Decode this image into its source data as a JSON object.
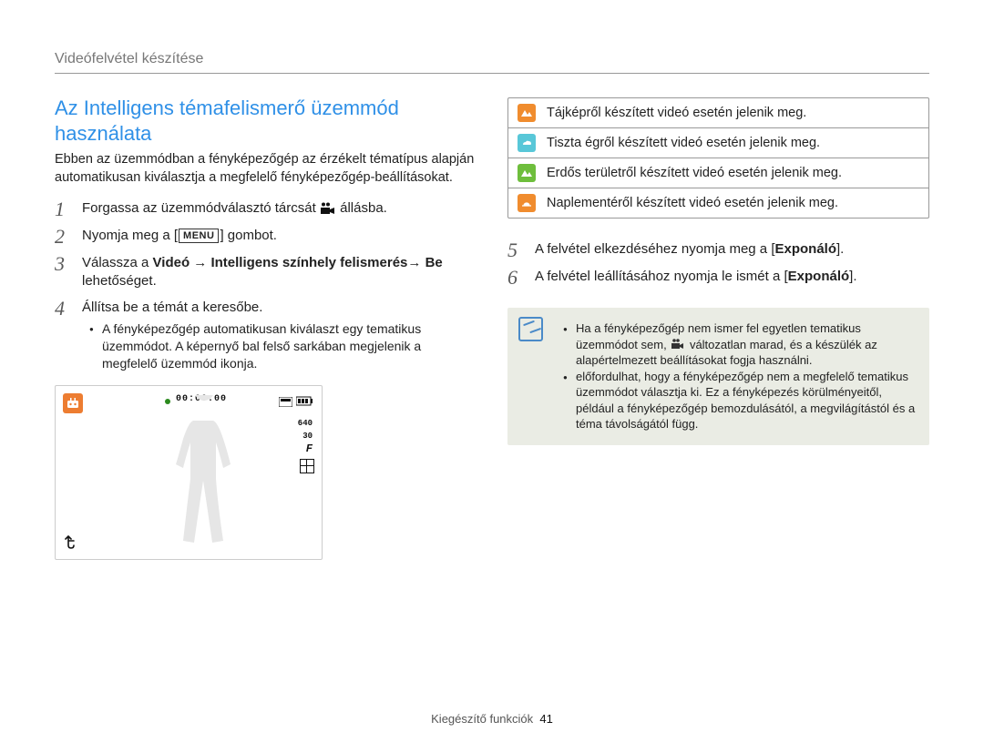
{
  "header": "Videófelvétel készítése",
  "section_title": "Az Intelligens témafelismerő üzemmód használata",
  "intro": "Ebben az üzemmódban a fényképezőgép az érzékelt tématípus alapján automatikusan kiválasztja a megfelelő fényképezőgép-beállításokat.",
  "step1_a": "Forgassa az üzemmódválasztó tárcsát ",
  "step1_b": " állásba.",
  "step2_a": "Nyomja meg a ",
  "step2_key": "MENU",
  "step2_b": " gombot.",
  "step3_a": "Válassza a ",
  "step3_b": "Videó",
  "step3_arrow1": " → ",
  "step3_c": "Intelligens színhely felismerés",
  "step3_arrow2": "→ ",
  "step3_d": "Be",
  "step3_e": " lehetőséget.",
  "step4": "Állítsa be a témát a keresőbe.",
  "step4_bullet": "A fényképezőgép automatikusan kiválaszt egy tematikus üzemmódot. A képernyő bal felső sarkában megjelenik a megfelelő üzemmód ikonja.",
  "camera": {
    "time": "00:00:00",
    "res": "640",
    "fps": "30",
    "flash": "F"
  },
  "scenes": [
    {
      "color": "#F08C2E",
      "desc": "Tájképről készített videó esetén jelenik meg."
    },
    {
      "color": "#58C7D8",
      "desc": "Tiszta égről készített videó esetén jelenik meg."
    },
    {
      "color": "#6EBE3C",
      "desc": "Erdős területről készített videó esetén jelenik meg."
    },
    {
      "color": "#F08C2E",
      "desc": "Naplementéről készített videó esetén jelenik meg."
    }
  ],
  "step5_a": "A felvétel elkezdéséhez nyomja meg a [",
  "step5_b": "Exponáló",
  "step5_c": "].",
  "step6_a": "A felvétel leállításához nyomja le ismét a [",
  "step6_b": "Exponáló",
  "step6_c": "].",
  "note1_a": "Ha a fényképezőgép nem ismer fel egyetlen tematikus üzemmódot sem, ",
  "note1_b": " változatlan marad, és a készülék az alapértelmezett beállításokat fogja használni.",
  "note2": "előfordulhat, hogy a fényképezőgép nem a megfelelő tematikus üzemmódot választja ki. Ez a fényképezés körülményeitől, például a fényképezőgép bemozdulásától, a megvilágítástól és a téma távolságától függ.",
  "footer_label": "Kiegészítő funkciók",
  "footer_num": "41"
}
